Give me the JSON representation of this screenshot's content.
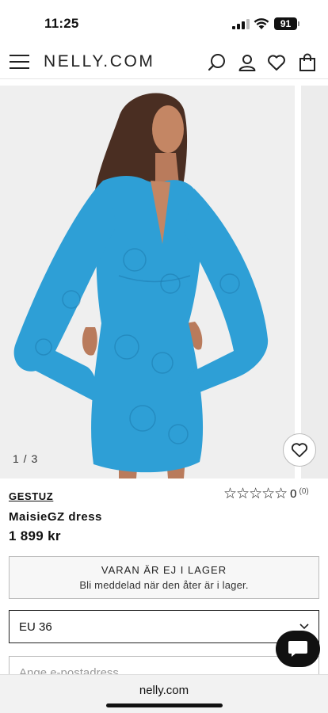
{
  "status_bar": {
    "time": "11:25",
    "battery": "91"
  },
  "header": {
    "logo": "NELLY.COM",
    "icons": [
      "menu-icon",
      "search-icon",
      "account-icon",
      "heart-icon",
      "bag-icon"
    ]
  },
  "gallery": {
    "counter": "1 / 3"
  },
  "product": {
    "brand": "GESTUZ",
    "name": "MaisieGZ dress",
    "price": "1 899 kr",
    "rating": {
      "stars_label": "☆☆☆☆☆",
      "value": "0",
      "count": "(0)"
    }
  },
  "stock": {
    "title": "VARAN ÄR EJ I LAGER",
    "subtitle": "Bli meddelad när den åter är i lager."
  },
  "size": {
    "selected": "EU 36"
  },
  "notify": {
    "email_placeholder": "Ange e-postadress"
  },
  "browser": {
    "url": "nelly.com"
  },
  "colors": {
    "dress": "#2e9fd6",
    "background": "#efefef",
    "text": "#111111"
  }
}
